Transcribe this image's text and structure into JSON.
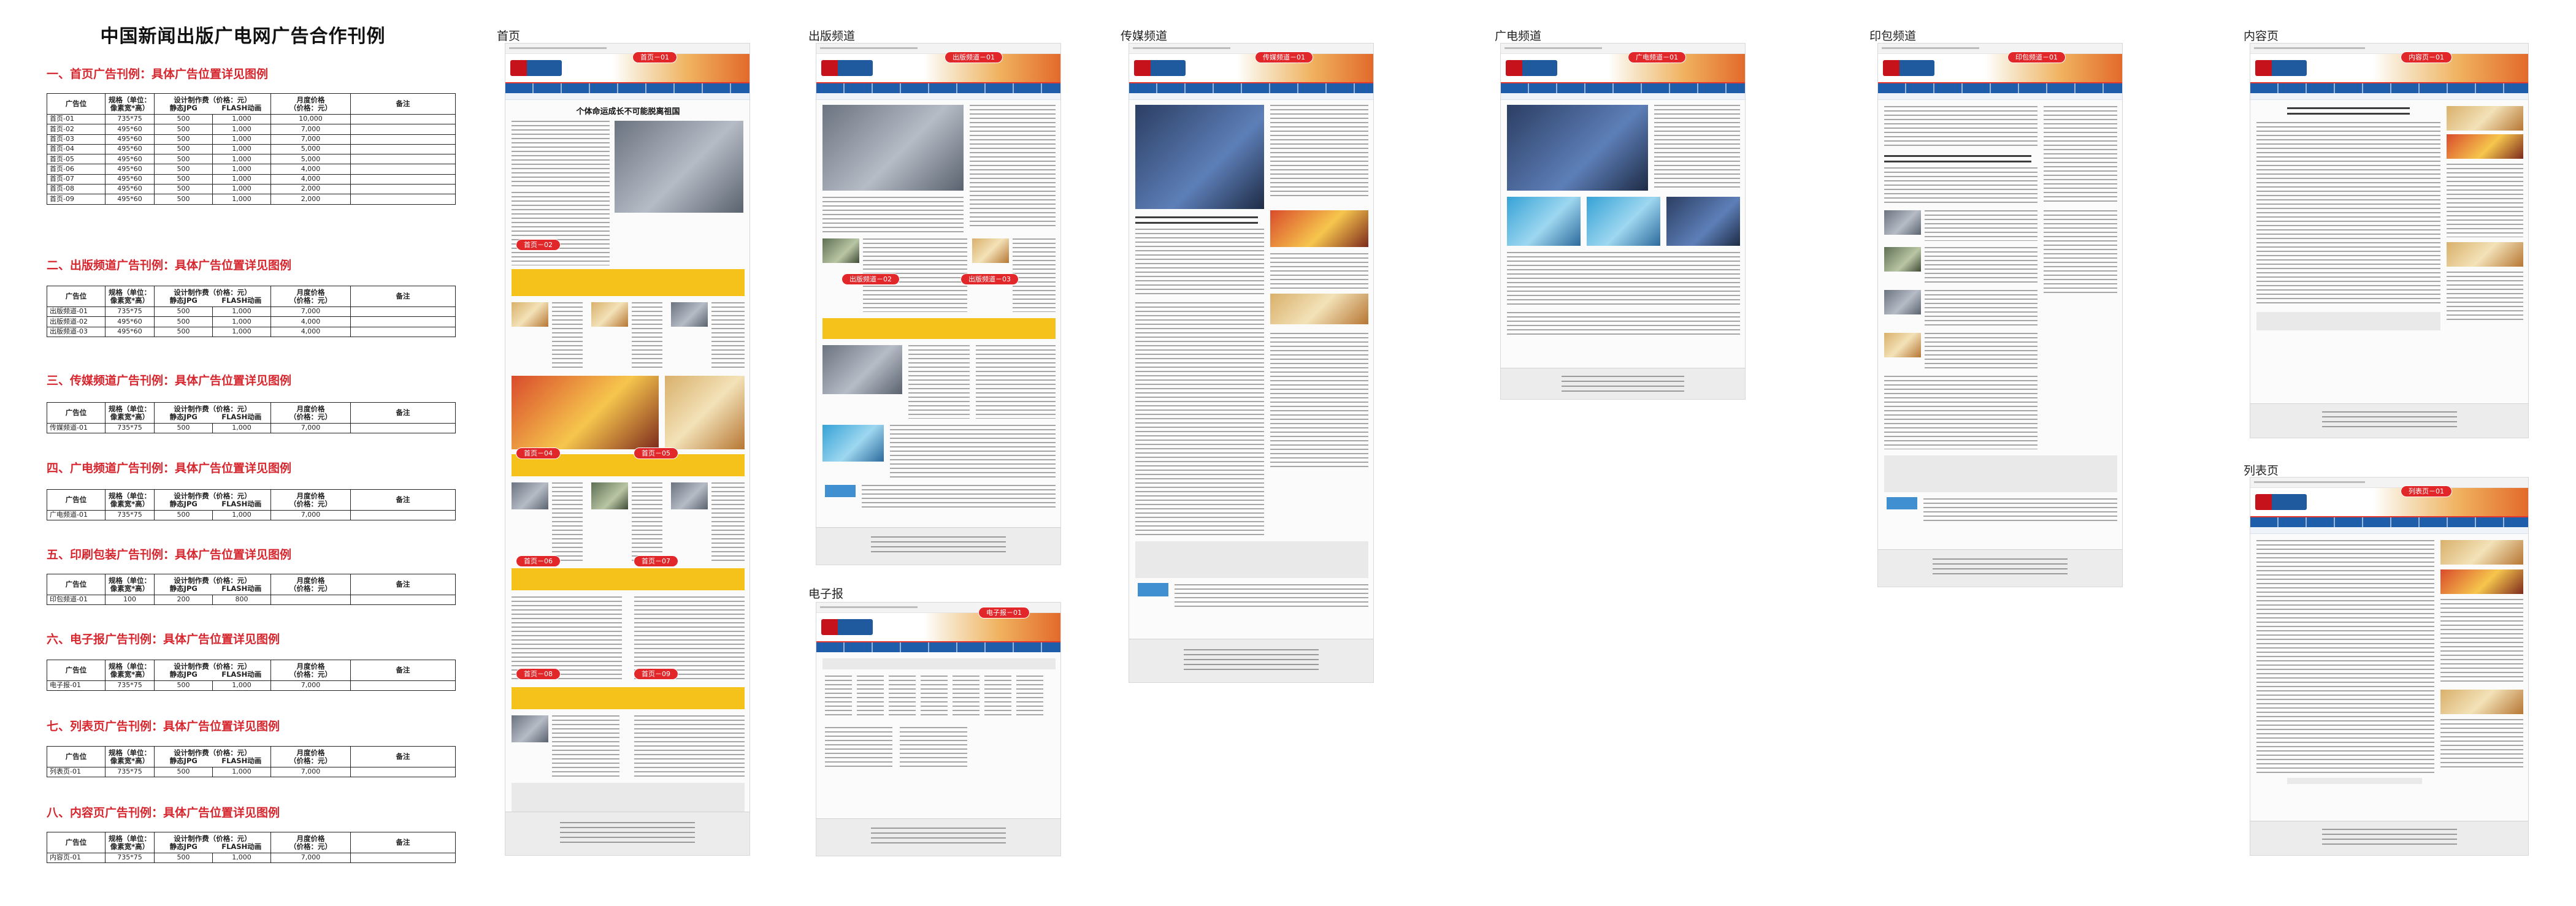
{
  "title": "中国新闻出版广电网广告合作刊例",
  "columns": {
    "type": "广告位",
    "size": [
      "规格（单位：",
      "像素宽*高）"
    ],
    "fee": [
      "设计制作费（价格：元）",
      "静态JPG"
    ],
    "fee_flash": "FLASH动画",
    "monthly": [
      "月度价格",
      "（价格：元）"
    ],
    "note": "备注"
  },
  "sections": [
    {
      "heading": "一、首页广告刊例：具体广告位置详见图例",
      "rows": [
        {
          "name": "首页-01",
          "size": "735*75",
          "jpg": "500",
          "flash": "1,000",
          "price": "10,000"
        },
        {
          "name": "首页-02",
          "size": "495*60",
          "jpg": "500",
          "flash": "1,000",
          "price": "7,000"
        },
        {
          "name": "首页-03",
          "size": "495*60",
          "jpg": "500",
          "flash": "1,000",
          "price": "7,000"
        },
        {
          "name": "首页-04",
          "size": "495*60",
          "jpg": "500",
          "flash": "1,000",
          "price": "5,000"
        },
        {
          "name": "首页-05",
          "size": "495*60",
          "jpg": "500",
          "flash": "1,000",
          "price": "5,000"
        },
        {
          "name": "首页-06",
          "size": "495*60",
          "jpg": "500",
          "flash": "1,000",
          "price": "4,000"
        },
        {
          "name": "首页-07",
          "size": "495*60",
          "jpg": "500",
          "flash": "1,000",
          "price": "4,000"
        },
        {
          "name": "首页-08",
          "size": "495*60",
          "jpg": "500",
          "flash": "1,000",
          "price": "2,000"
        },
        {
          "name": "首页-09",
          "size": "495*60",
          "jpg": "500",
          "flash": "1,000",
          "price": "2,000"
        }
      ]
    },
    {
      "heading": "二、出版频道广告刊例：具体广告位置详见图例",
      "rows": [
        {
          "name": "出版频道-01",
          "size": "735*75",
          "jpg": "500",
          "flash": "1,000",
          "price": "7,000"
        },
        {
          "name": "出版频道-02",
          "size": "495*60",
          "jpg": "500",
          "flash": "1,000",
          "price": "4,000"
        },
        {
          "name": "出版频道-03",
          "size": "495*60",
          "jpg": "500",
          "flash": "1,000",
          "price": "4,000"
        }
      ]
    },
    {
      "heading": "三、传媒频道广告刊例：具体广告位置详见图例",
      "rows": [
        {
          "name": "传媒频道-01",
          "size": "735*75",
          "jpg": "500",
          "flash": "1,000",
          "price": "7,000"
        }
      ]
    },
    {
      "heading": "四、广电频道广告刊例：具体广告位置详见图例",
      "rows": [
        {
          "name": "广电频道-01",
          "size": "735*75",
          "jpg": "500",
          "flash": "1,000",
          "price": "7,000"
        }
      ]
    },
    {
      "heading": "五、印刷包装广告刊例：具体广告位置详见图例",
      "rows": [
        {
          "name": "印包频道-01",
          "size": "100",
          "jpg": "200",
          "flash": "800",
          "price": ""
        }
      ]
    },
    {
      "heading": "六、电子报广告刊例：具体广告位置详见图例",
      "rows": [
        {
          "name": "电子报-01",
          "size": "735*75",
          "jpg": "500",
          "flash": "1,000",
          "price": "7,000"
        }
      ]
    },
    {
      "heading": "七、列表页广告刊例：具体广告位置详见图例",
      "rows": [
        {
          "name": "列表页-01",
          "size": "735*75",
          "jpg": "500",
          "flash": "1,000",
          "price": "7,000"
        }
      ]
    },
    {
      "heading": "八、内容页广告刊例：具体广告位置详见图例",
      "rows": [
        {
          "name": "内容页-01",
          "size": "735*75",
          "jpg": "500",
          "flash": "1,000",
          "price": "7,000"
        }
      ]
    }
  ],
  "thumbnails": {
    "home": {
      "caption": "首页",
      "tags": [
        "首页－01",
        "首页－02",
        "首页－04",
        "首页－05",
        "首页－06",
        "首页－07",
        "首页－08",
        "首页－09"
      ],
      "headline": "个体命运成长不可能脱离祖国"
    },
    "publishing": {
      "caption": "出版频道",
      "tags": [
        "出版频道－01",
        "出版频道－02",
        "出版频道－03"
      ]
    },
    "media": {
      "caption": "传媒频道",
      "tags": [
        "传媒频道－01"
      ]
    },
    "broadcast": {
      "caption": "广电频道",
      "tags": [
        "广电频道－01"
      ]
    },
    "printing": {
      "caption": "印包频道",
      "tags": [
        "印包频道－01"
      ]
    },
    "epaper": {
      "caption": "电子报",
      "tags": [
        "电子报－01"
      ]
    },
    "content": {
      "caption": "内容页",
      "tags": [
        "内容页－01"
      ]
    },
    "list": {
      "caption": "列表页",
      "tags": [
        "列表页－01"
      ]
    }
  }
}
